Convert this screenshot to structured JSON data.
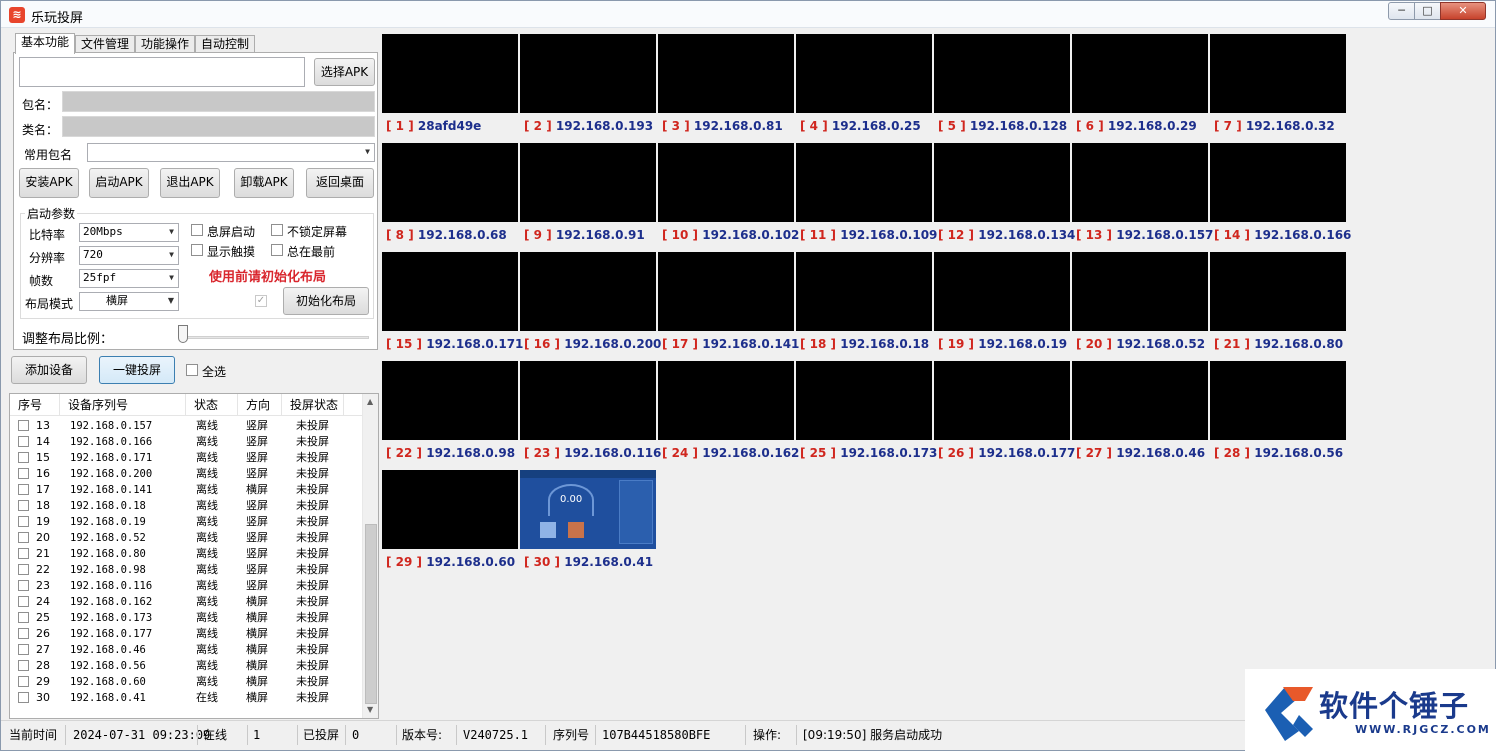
{
  "window": {
    "title": "乐玩投屏",
    "min": "─",
    "max": "□",
    "close": "✕"
  },
  "tabs": [
    "基本功能",
    "文件管理",
    "功能操作",
    "自动控制"
  ],
  "basic": {
    "select_apk": "选择APK",
    "package_label": "包名：",
    "class_label": "类名：",
    "common_pkg_label": "常用包名",
    "buttons": [
      "安装APK",
      "启动APK",
      "退出APK",
      "卸载APK",
      "返回桌面"
    ],
    "params_title": "启动参数",
    "bitrate_label": "比特率",
    "bitrate_value": "20Mbps",
    "resolution_label": "分辨率",
    "resolution_value": "720",
    "fps_label": "帧数",
    "fps_value": "25fpf",
    "layout_label": "布局模式",
    "layout_value": "横屏",
    "chk_screen_off": "息屏启动",
    "chk_unlock": "不锁定屏幕",
    "chk_touch": "显示触摸",
    "chk_top": "总在最前",
    "warning": "使用前请初始化布局",
    "init_layout": "初始化布局",
    "ratio_label": "调整布局比例："
  },
  "actions": {
    "add_device": "添加设备",
    "cast_all": "一键投屏",
    "select_all": "全选"
  },
  "table": {
    "headers": [
      "序号",
      "设备序列号",
      "状态",
      "方向",
      "投屏状态"
    ],
    "rows": [
      [
        "13",
        "192.168.0.157",
        "离线",
        "竖屏",
        "未投屏"
      ],
      [
        "14",
        "192.168.0.166",
        "离线",
        "竖屏",
        "未投屏"
      ],
      [
        "15",
        "192.168.0.171",
        "离线",
        "竖屏",
        "未投屏"
      ],
      [
        "16",
        "192.168.0.200",
        "离线",
        "竖屏",
        "未投屏"
      ],
      [
        "17",
        "192.168.0.141",
        "离线",
        "横屏",
        "未投屏"
      ],
      [
        "18",
        "192.168.0.18",
        "离线",
        "竖屏",
        "未投屏"
      ],
      [
        "19",
        "192.168.0.19",
        "离线",
        "竖屏",
        "未投屏"
      ],
      [
        "20",
        "192.168.0.52",
        "离线",
        "竖屏",
        "未投屏"
      ],
      [
        "21",
        "192.168.0.80",
        "离线",
        "竖屏",
        "未投屏"
      ],
      [
        "22",
        "192.168.0.98",
        "离线",
        "竖屏",
        "未投屏"
      ],
      [
        "23",
        "192.168.0.116",
        "离线",
        "竖屏",
        "未投屏"
      ],
      [
        "24",
        "192.168.0.162",
        "离线",
        "横屏",
        "未投屏"
      ],
      [
        "25",
        "192.168.0.173",
        "离线",
        "横屏",
        "未投屏"
      ],
      [
        "26",
        "192.168.0.177",
        "离线",
        "横屏",
        "未投屏"
      ],
      [
        "27",
        "192.168.0.46",
        "离线",
        "横屏",
        "未投屏"
      ],
      [
        "28",
        "192.168.0.56",
        "离线",
        "横屏",
        "未投屏"
      ],
      [
        "29",
        "192.168.0.60",
        "离线",
        "横屏",
        "未投屏"
      ],
      [
        "30",
        "192.168.0.41",
        "在线",
        "横屏",
        "未投屏"
      ]
    ]
  },
  "screens": [
    {
      "idx": "[ 1 ]",
      "ip": "28afd49e"
    },
    {
      "idx": "[ 2 ]",
      "ip": "192.168.0.193"
    },
    {
      "idx": "[ 3 ]",
      "ip": "192.168.0.81"
    },
    {
      "idx": "[ 4 ]",
      "ip": "192.168.0.25"
    },
    {
      "idx": "[ 5 ]",
      "ip": "192.168.0.128"
    },
    {
      "idx": "[ 6 ]",
      "ip": "192.168.0.29"
    },
    {
      "idx": "[ 7 ]",
      "ip": "192.168.0.32"
    },
    {
      "idx": "[ 8 ]",
      "ip": "192.168.0.68"
    },
    {
      "idx": "[ 9 ]",
      "ip": "192.168.0.91"
    },
    {
      "idx": "[ 10 ]",
      "ip": "192.168.0.102"
    },
    {
      "idx": "[ 11 ]",
      "ip": "192.168.0.109"
    },
    {
      "idx": "[ 12 ]",
      "ip": "192.168.0.134"
    },
    {
      "idx": "[ 13 ]",
      "ip": "192.168.0.157"
    },
    {
      "idx": "[ 14 ]",
      "ip": "192.168.0.166"
    },
    {
      "idx": "[ 15 ]",
      "ip": "192.168.0.171"
    },
    {
      "idx": "[ 16 ]",
      "ip": "192.168.0.200"
    },
    {
      "idx": "[ 17 ]",
      "ip": "192.168.0.141"
    },
    {
      "idx": "[ 18 ]",
      "ip": "192.168.0.18"
    },
    {
      "idx": "[ 19 ]",
      "ip": "192.168.0.19"
    },
    {
      "idx": "[ 20 ]",
      "ip": "192.168.0.52"
    },
    {
      "idx": "[ 21 ]",
      "ip": "192.168.0.80"
    },
    {
      "idx": "[ 22 ]",
      "ip": "192.168.0.98"
    },
    {
      "idx": "[ 23 ]",
      "ip": "192.168.0.116"
    },
    {
      "idx": "[ 24 ]",
      "ip": "192.168.0.162"
    },
    {
      "idx": "[ 25 ]",
      "ip": "192.168.0.173"
    },
    {
      "idx": "[ 26 ]",
      "ip": "192.168.0.177"
    },
    {
      "idx": "[ 27 ]",
      "ip": "192.168.0.46"
    },
    {
      "idx": "[ 28 ]",
      "ip": "192.168.0.56"
    },
    {
      "idx": "[ 29 ]",
      "ip": "192.168.0.60"
    },
    {
      "idx": "[ 30 ]",
      "ip": "192.168.0.41",
      "live": true,
      "live_value": "0.00"
    }
  ],
  "status": {
    "time_label": "当前时间",
    "time_value": "2024-07-31 09:23:09",
    "online_label": "在线",
    "online_value": "1",
    "cast_label": "已投屏",
    "cast_value": "0",
    "version_label": "版本号:",
    "version_value": "V240725.1",
    "serial_label": "序列号",
    "serial_value": "107B44518580BFE",
    "op_label": "操作:",
    "op_value": "[09:19:50] 服务启动成功"
  },
  "watermark": {
    "name": "软件个锤子",
    "url": "WWW.RJGCZ.COM"
  },
  "colors": {
    "index_red": "#d0261e",
    "ip_blue": "#1d2f8c",
    "warning_red": "#d9262d",
    "screen_bg": "#000000",
    "live_blue": "#1f4f9e"
  }
}
